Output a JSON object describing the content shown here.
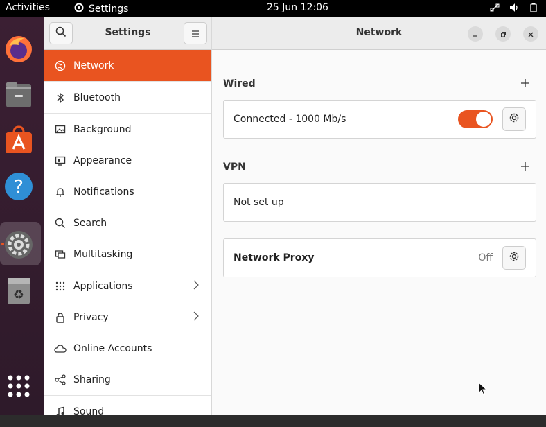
{
  "topbar": {
    "activities": "Activities",
    "app_name": "Settings",
    "clock": "25 Jun  12:06"
  },
  "dock": {
    "items": [
      "firefox-icon",
      "files-icon",
      "software-icon",
      "help-icon",
      "settings-icon",
      "trash-icon",
      "show-apps-icon"
    ]
  },
  "sidebar": {
    "title": "Settings",
    "items": [
      {
        "label": "Network",
        "icon": "network-icon"
      },
      {
        "label": "Bluetooth",
        "icon": "bluetooth-icon"
      },
      {
        "label": "Background",
        "icon": "background-icon"
      },
      {
        "label": "Appearance",
        "icon": "appearance-icon"
      },
      {
        "label": "Notifications",
        "icon": "bell-icon"
      },
      {
        "label": "Search",
        "icon": "search-icon"
      },
      {
        "label": "Multitasking",
        "icon": "multitasking-icon"
      },
      {
        "label": "Applications",
        "icon": "grid-icon"
      },
      {
        "label": "Privacy",
        "icon": "lock-icon"
      },
      {
        "label": "Online Accounts",
        "icon": "cloud-icon"
      },
      {
        "label": "Sharing",
        "icon": "share-icon"
      },
      {
        "label": "Sound",
        "icon": "music-note-icon"
      }
    ]
  },
  "main": {
    "title": "Network",
    "wired": {
      "label": "Wired",
      "status": "Connected - 1000 Mb/s",
      "enabled": true
    },
    "vpn": {
      "label": "VPN",
      "status": "Not set up"
    },
    "proxy": {
      "label": "Network Proxy",
      "state": "Off"
    }
  },
  "colors": {
    "accent": "#e95420",
    "topbar": "#000000"
  }
}
